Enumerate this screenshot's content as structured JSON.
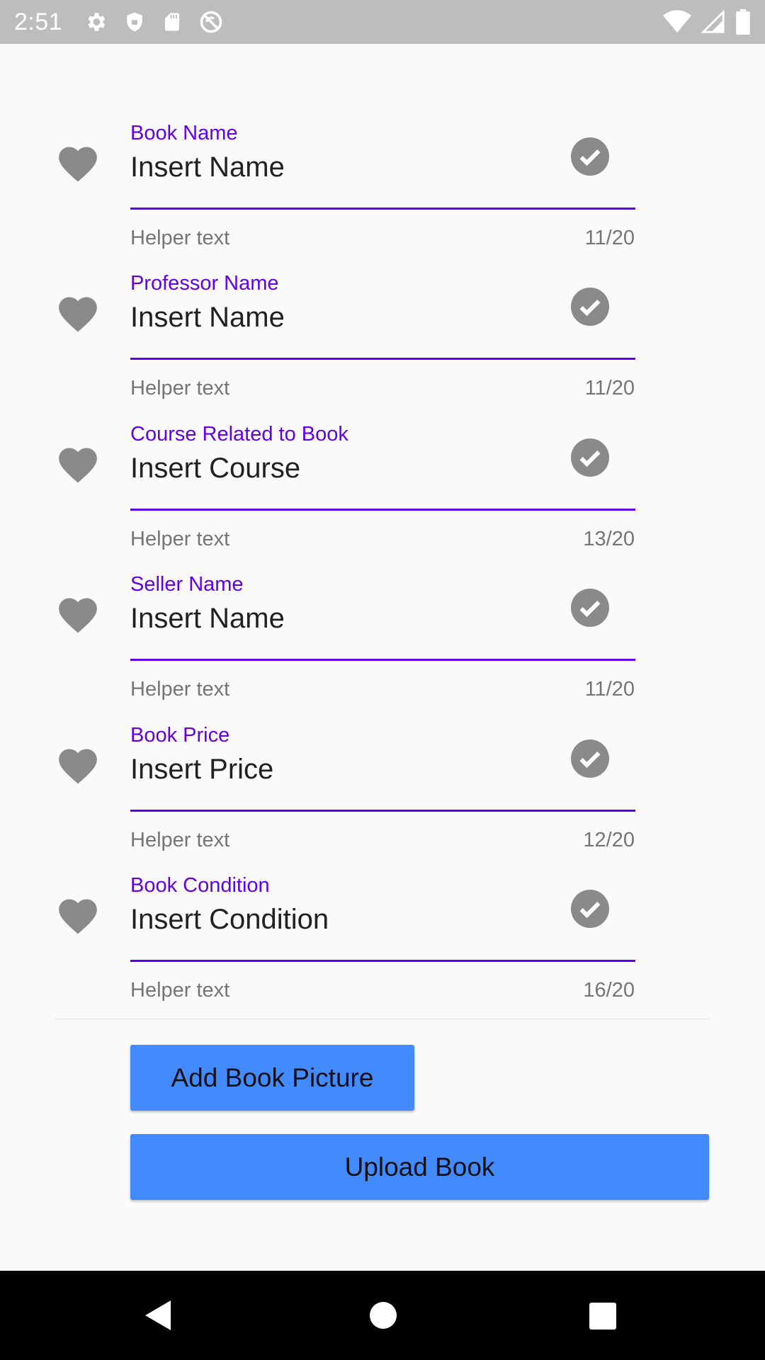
{
  "status_bar": {
    "time": "2:51",
    "icons_left": [
      "gear-icon",
      "shield-icon",
      "sd-card-icon",
      "no-sync-icon"
    ],
    "icons_right": [
      "wifi-icon",
      "signal-icon",
      "battery-icon"
    ]
  },
  "fields": [
    {
      "label": "Book Name",
      "value": "Insert Name",
      "helper": "Helper text",
      "counter": "11/20"
    },
    {
      "label": "Professor Name",
      "value": "Insert Name",
      "helper": "Helper text",
      "counter": "11/20"
    },
    {
      "label": "Course Related to Book",
      "value": "Insert Course",
      "helper": "Helper text",
      "counter": "13/20"
    },
    {
      "label": "Seller Name",
      "value": "Insert Name",
      "helper": "Helper text",
      "counter": "11/20"
    },
    {
      "label": "Book Price",
      "value": "Insert Price",
      "helper": "Helper text",
      "counter": "12/20"
    },
    {
      "label": "Book Condition",
      "value": "Insert Condition",
      "helper": "Helper text",
      "counter": "16/20"
    }
  ],
  "buttons": {
    "add_picture": "Add Book Picture",
    "upload": "Upload Book"
  },
  "colors": {
    "accent": "#6200ee",
    "button": "#448aff",
    "status_bar": "#bdbdbd",
    "icon_gray": "#8a8a8a"
  }
}
